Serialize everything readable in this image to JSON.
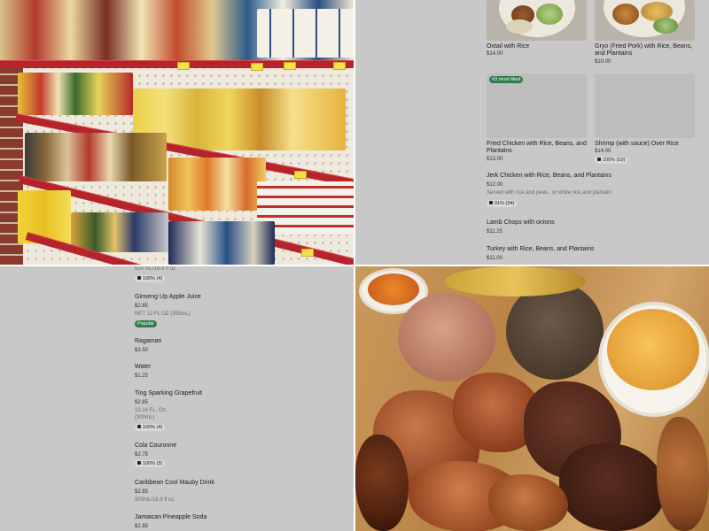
{
  "menu_top": {
    "cards": [
      {
        "name": "Oxtail with Rice",
        "price": "$14.00"
      },
      {
        "name": "Gryo (Fried Pork) with Rice, Beans, and Plantains",
        "price": "$10.00"
      },
      {
        "badge": "#3 most liked",
        "name": "Fried Chicken with Rice, Beans, and Plantains",
        "price": "$13.00"
      },
      {
        "name": "Shrimp (with sauce) Over Rice",
        "price": "$14.00",
        "likes": "100% (10)"
      }
    ],
    "list": [
      {
        "name": "Jerk Chicken with Rice, Beans, and Plantains",
        "price": "$12.00",
        "desc": "Served with rice and peas , or white rice and plantain",
        "likes": "91% (34)"
      },
      {
        "name": "Lamb Chops with onions",
        "price": "$11.25"
      },
      {
        "name": "Turkey with Rice, Beans, and Plantains",
        "price": "$11.00"
      }
    ]
  },
  "drinks": {
    "top_partial_desc": "500 mL/16.9 fl oz",
    "top_partial_likes": "100% (4)",
    "items": [
      {
        "name": "Ginseng Up Apple Juice",
        "price": "$2.85",
        "desc": "NET 12 FL OZ (355mL)",
        "tag": "Popular"
      },
      {
        "name": "Ragaman",
        "price": "$3.50"
      },
      {
        "name": "Water",
        "price": "$1.25"
      },
      {
        "name": "Ting Sparking Grapefruit",
        "price": "$2.85",
        "desc1": "10.14 FL. Oz.",
        "desc2": "(300mL)",
        "likes": "100% (4)"
      },
      {
        "name": "Cola Couronne",
        "price": "$2.75",
        "likes": "100% (3)"
      },
      {
        "name": "Caribbean Cool Mauby Drink",
        "price": "$2.85",
        "desc": "500mL/16.9 fl oz"
      },
      {
        "name": "Jamaican Pineapple Soda",
        "price": "$2.85"
      }
    ]
  },
  "colors": {
    "panel_bg": "#c8c8c8",
    "popular_green": "#2f7d4b",
    "shelf_red": "#b4242a"
  }
}
